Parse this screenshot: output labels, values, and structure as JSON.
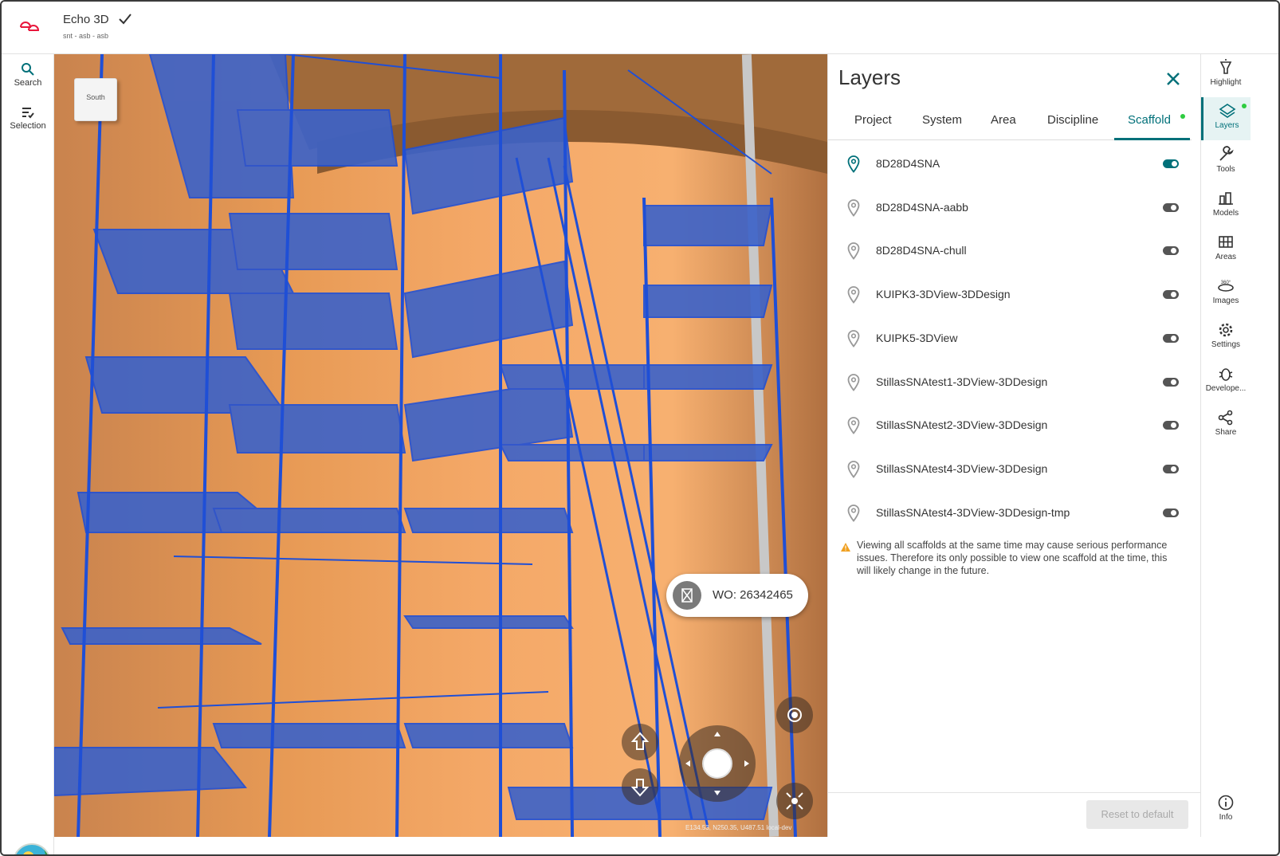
{
  "app": {
    "title": "Echo 3D",
    "subtitle": "snt - asb - asb"
  },
  "left_rail": [
    {
      "label": "Search",
      "icon": "search-icon"
    },
    {
      "label": "Selection",
      "icon": "selection-icon"
    }
  ],
  "viewport": {
    "nav_cube_label": "South",
    "work_order": "WO: 26342465",
    "coords": "E134.53, N250.35, U487.51   local-dev"
  },
  "layers_panel": {
    "title": "Layers",
    "tabs": [
      "Project",
      "System",
      "Area",
      "Discipline",
      "Scaffold"
    ],
    "active_tab": "Scaffold",
    "items": [
      {
        "name": "8D28D4SNA",
        "enabled": true
      },
      {
        "name": "8D28D4SNA-aabb",
        "enabled": false
      },
      {
        "name": "8D28D4SNA-chull",
        "enabled": false
      },
      {
        "name": "KUIPK3-3DView-3DDesign",
        "enabled": false
      },
      {
        "name": "KUIPK5-3DView",
        "enabled": false
      },
      {
        "name": "StillasSNAtest1-3DView-3DDesign",
        "enabled": false
      },
      {
        "name": "StillasSNAtest2-3DView-3DDesign",
        "enabled": false
      },
      {
        "name": "StillasSNAtest4-3DView-3DDesign",
        "enabled": false
      },
      {
        "name": "StillasSNAtest4-3DView-3DDesign-tmp",
        "enabled": false
      }
    ],
    "warning": "Viewing all scaffolds at the same time may cause serious performance issues. Therefore its only possible to view one scaffold at the time, this will likely change in the future.",
    "reset_label": "Reset to default"
  },
  "right_rail": [
    {
      "label": "Highlight",
      "icon": "highlight-icon"
    },
    {
      "label": "Layers",
      "icon": "layers-icon"
    },
    {
      "label": "Tools",
      "icon": "wrench-icon"
    },
    {
      "label": "Models",
      "icon": "models-icon"
    },
    {
      "label": "Areas",
      "icon": "grid-icon"
    },
    {
      "label": "Images",
      "icon": "360-icon"
    },
    {
      "label": "Settings",
      "icon": "gear-icon"
    },
    {
      "label": "Develope...",
      "icon": "bug-icon"
    },
    {
      "label": "Share",
      "icon": "share-icon"
    },
    {
      "label": "Info",
      "icon": "info-icon"
    }
  ],
  "colors": {
    "accent": "#007079",
    "scaffold": "#1f4fd6",
    "logo": "#e8173c",
    "status_dot": "#2ecc40"
  }
}
